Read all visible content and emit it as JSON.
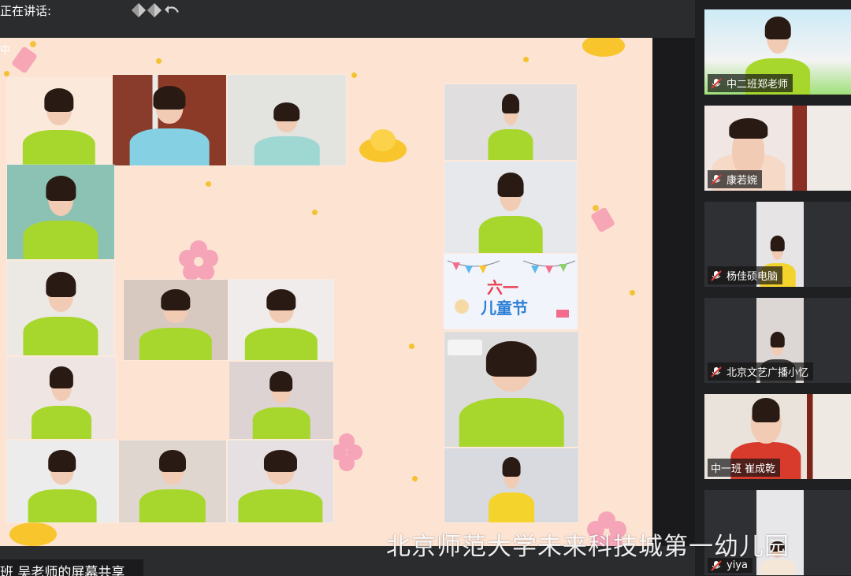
{
  "topbar": {
    "speaking_label": "正在讲话:",
    "icons": [
      "diamond-icon",
      "undo-icon"
    ]
  },
  "share": {
    "label": "中"
  },
  "colors": {
    "background": "#fde3d2",
    "uniform": "#a7d72c",
    "panel": "#1f2022",
    "mic_muted": "#e53935"
  },
  "tiles": [
    {
      "id": "t1"
    },
    {
      "id": "t2"
    },
    {
      "id": "t3"
    },
    {
      "id": "t4"
    },
    {
      "id": "t5"
    },
    {
      "id": "t6"
    },
    {
      "id": "t7"
    },
    {
      "id": "t8"
    },
    {
      "id": "t9"
    },
    {
      "id": "t10"
    },
    {
      "id": "t11"
    },
    {
      "id": "t12"
    },
    {
      "id": "t13"
    },
    {
      "id": "t14"
    },
    {
      "id": "t15"
    },
    {
      "id": "t16"
    },
    {
      "id": "t17"
    }
  ],
  "banner": {
    "text_line1": "六一",
    "text_line2": "儿童节"
  },
  "participants": [
    {
      "name": "中二班郑老师",
      "mic": "muted"
    },
    {
      "name": "康若婉",
      "mic": "muted"
    },
    {
      "name": "杨佳硕电脑",
      "mic": "muted"
    },
    {
      "name": "北京文艺广播小忆",
      "mic": "muted"
    },
    {
      "name": "中一班 崔成乾",
      "mic": "none"
    },
    {
      "name": "yiya",
      "mic": "muted"
    }
  ],
  "watermark": "北京师范大学未来科技城第一幼儿园",
  "subtitle": "班 吴老师的屏幕共享"
}
